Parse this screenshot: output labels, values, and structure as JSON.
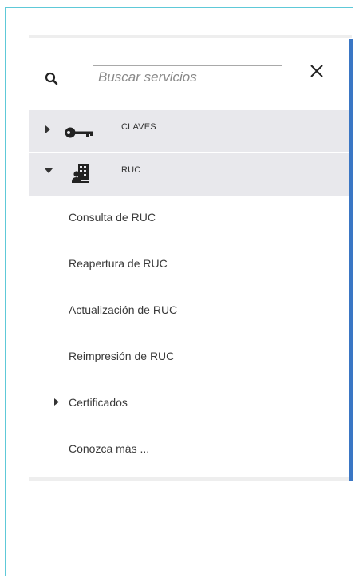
{
  "search": {
    "placeholder": "Buscar servicios",
    "value": ""
  },
  "categories": [
    {
      "label": "CLAVES",
      "icon": "key-icon",
      "expanded": false
    },
    {
      "label": "RUC",
      "icon": "building-person-icon",
      "expanded": true
    }
  ],
  "ruc_items": [
    {
      "label": "Consulta de RUC"
    },
    {
      "label": "Reapertura de RUC"
    },
    {
      "label": "Actualización de RUC"
    },
    {
      "label": "Reimpresión de RUC"
    },
    {
      "label": "Certificados",
      "has_children": true,
      "expanded": false
    },
    {
      "label": "Conozca más ..."
    }
  ],
  "colors": {
    "frame_border": "#5ec9d8",
    "accent_bar": "#3a76c4",
    "category_bg": "#e8e8ec"
  }
}
